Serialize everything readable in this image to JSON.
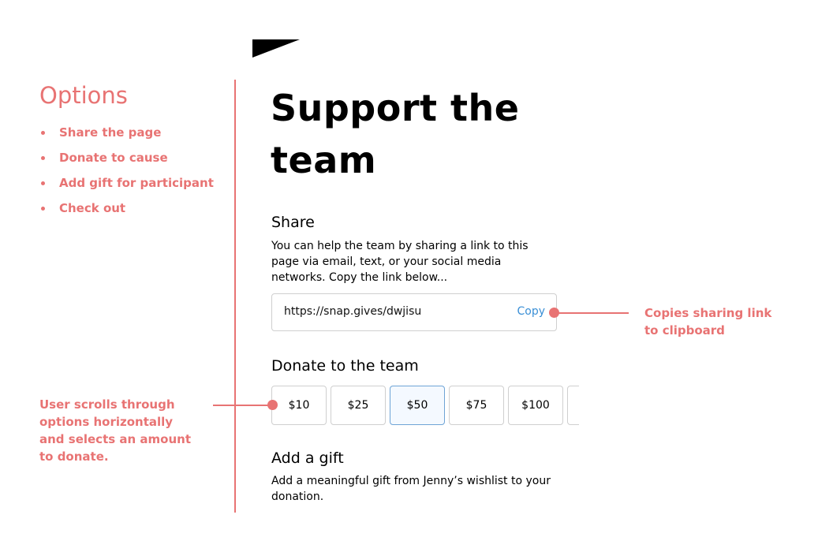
{
  "sidebar": {
    "title": "Options",
    "items": [
      {
        "label": "Share the page"
      },
      {
        "label": "Donate to cause"
      },
      {
        "label": "Add gift for participant"
      },
      {
        "label": "Check out"
      }
    ]
  },
  "main": {
    "title": "Support the team",
    "share": {
      "heading": "Share",
      "body": "You can help the team by sharing a link to this page via email, text, or your social media networks. Copy the link below...",
      "link": "https://snap.gives/dwjisu",
      "copy_label": "Copy"
    },
    "donate": {
      "heading": "Donate to the team",
      "amounts": [
        "$10",
        "$25",
        "$50",
        "$75",
        "$100",
        ""
      ],
      "selected": "$50"
    },
    "gift": {
      "heading": "Add a gift",
      "body": "Add a meaningful gift from Jenny’s wishlist to your donation."
    }
  },
  "annotations": {
    "copy_note": "Copies sharing link to clipboard",
    "scroll_note": "User scrolls through options horizontally and selects an amount to donate."
  },
  "colors": {
    "annotation": "#e87373",
    "link_blue": "#3a8fd6",
    "selected_border": "#6ea4d6"
  }
}
